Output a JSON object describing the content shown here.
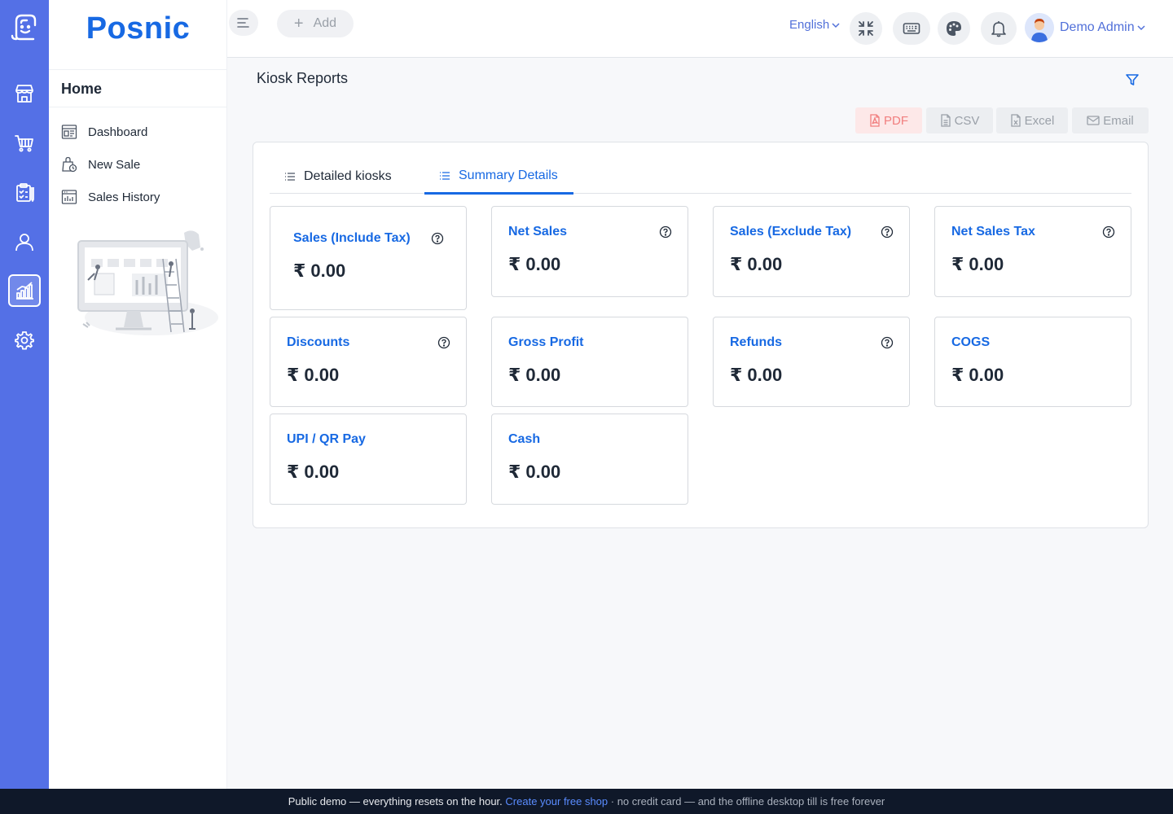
{
  "brand": {
    "name": "Posnic"
  },
  "rail": {
    "icons": [
      "app-logo-icon",
      "store-icon",
      "cart-icon",
      "clipboard-icon",
      "user-icon",
      "reports-chart-icon",
      "settings-icon"
    ],
    "active": "reports-chart-icon",
    "color": "#5470e6"
  },
  "sidebar": {
    "section": "Home",
    "items": [
      {
        "label": "Dashboard",
        "icon": "dashboard-icon"
      },
      {
        "label": "New Sale",
        "icon": "new-sale-bag-icon"
      },
      {
        "label": "Sales History",
        "icon": "sales-history-icon"
      }
    ]
  },
  "topbar": {
    "add_label": "Add",
    "language": "English",
    "user_name": "Demo Admin"
  },
  "page": {
    "title": "Kiosk Reports"
  },
  "export": {
    "pdf": "PDF",
    "csv": "CSV",
    "excel": "Excel",
    "email": "Email"
  },
  "tabs": [
    {
      "label": "Detailed kiosks",
      "active": false
    },
    {
      "label": "Summary Details",
      "active": true
    }
  ],
  "cards": [
    {
      "title": "Sales (Include Tax)",
      "value": "₹ 0.00",
      "help": true
    },
    {
      "title": "Net Sales",
      "value": "₹ 0.00",
      "help": true
    },
    {
      "title": "Sales (Exclude Tax)",
      "value": "₹ 0.00",
      "help": true
    },
    {
      "title": "Net Sales Tax",
      "value": "₹ 0.00",
      "help": true
    },
    {
      "title": "Discounts",
      "value": "₹ 0.00",
      "help": true
    },
    {
      "title": "Gross Profit",
      "value": "₹ 0.00",
      "help": false
    },
    {
      "title": "Refunds",
      "value": "₹ 0.00",
      "help": true
    },
    {
      "title": "COGS",
      "value": "₹ 0.00",
      "help": false
    },
    {
      "title": "UPI / QR Pay",
      "value": "₹ 0.00",
      "help": false
    },
    {
      "title": "Cash",
      "value": "₹ 0.00",
      "help": false
    }
  ],
  "footer": {
    "lead": "Public demo — everything resets on the hour.",
    "link": "Create your free shop",
    "tail": "· no credit card — and the offline desktop till is free forever"
  },
  "colors": {
    "accent": "#1769e3",
    "rail": "#5470e6",
    "pdf": "#f17e7e"
  }
}
